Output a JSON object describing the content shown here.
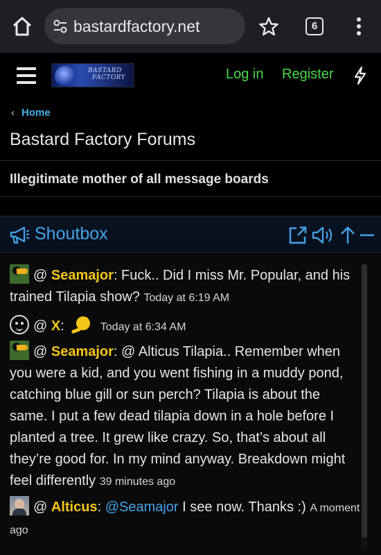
{
  "browser": {
    "url": "bastardfactory.net",
    "tab_count": "6",
    "icons": [
      "home-icon",
      "site-settings-icon",
      "bookmark-star-icon",
      "tab-switcher-icon",
      "more-menu-icon"
    ]
  },
  "header": {
    "logo_text_line1": "BASTARD",
    "logo_text_line2": "FACTORY",
    "login_label": "Log in",
    "register_label": "Register",
    "icons": [
      "hamburger-menu-icon",
      "lightning-bolt-icon"
    ],
    "link_color": "#4cd94c"
  },
  "breadcrumb": {
    "home_label": "Home"
  },
  "page": {
    "title": "Bastard Factory Forums",
    "tagline": "Illegitimate mother of all message boards"
  },
  "shoutbox": {
    "title": "Shoutbox",
    "icons": [
      "megaphone-icon",
      "popout-icon",
      "sound-icon",
      "scroll-up-icon",
      "collapse-icon"
    ],
    "accent_color": "#45a3ea",
    "username_color": "#f5c518",
    "messages": [
      {
        "at": "@",
        "user": "Seamajor",
        "text": ": Fuck.. Did I miss Mr. Popular, and his trained Tilapia show?",
        "time": "Today at 6:19 AM"
      },
      {
        "at": "@",
        "user": "X",
        "text": ":",
        "time": "Today at 6:34 AM"
      },
      {
        "at": "@",
        "user": "Seamajor",
        "text": ": @ Alticus Tilapia.. Remember when you were a kid, and you went fishing in a muddy pond, catching blue gill or sun perch? Tilapia is about the same. I put a few dead tilapia down in a hole before I planted a tree. It grew like crazy. So, that’s about all they’re good for. In my mind anyway. Breakdown might feel differently",
        "time": "39 minutes ago"
      },
      {
        "at": "@",
        "user": "Alticus",
        "text_prefix": ": ",
        "mention": "@Seamajor",
        "text": " I see now. Thanks :)",
        "time": "A moment ago"
      }
    ]
  }
}
